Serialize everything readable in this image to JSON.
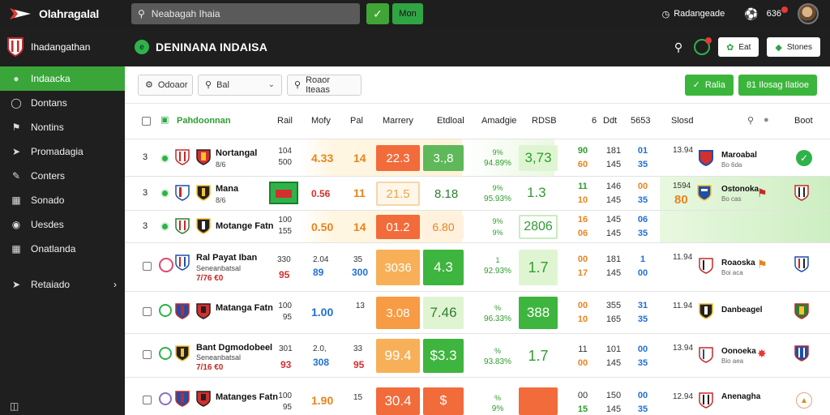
{
  "topbar": {
    "brand": "Olahragalal",
    "search_text": "Neabagah Ihaia",
    "go_label": "Mon",
    "clock_text": "Radangeade",
    "notif_text": "636"
  },
  "sidebar": {
    "header": "Ihadangathan",
    "items": [
      {
        "label": "Indaacka",
        "icon": "home-icon",
        "active": true
      },
      {
        "label": "Dontans",
        "icon": "circle-icon"
      },
      {
        "label": "Nontins",
        "icon": "flag-icon"
      },
      {
        "label": "Promadagia",
        "icon": "bolt-icon"
      },
      {
        "label": "Conters",
        "icon": "pencil-icon"
      },
      {
        "label": "Sonado",
        "icon": "car-icon"
      },
      {
        "label": "Uesdes",
        "icon": "eye-icon"
      },
      {
        "label": "Onatlanda",
        "icon": "grid-icon"
      },
      {
        "label": "Retaiado",
        "icon": "bolt-icon",
        "chevron": true
      }
    ]
  },
  "main": {
    "title": "DENINANA INDAISA",
    "btn1": "Eat",
    "btn2": "Stones"
  },
  "filters": {
    "f1": "Odoaor",
    "f2": "Bal",
    "f3": "Roaor Iteaas",
    "btn_apply": "Ralia",
    "btn_more": "81 Ilosag Ilatioe"
  },
  "table": {
    "headers": {
      "name": "Pahdoonnan",
      "h1": "Rail",
      "h2": "Mofy",
      "h3": "Pal",
      "h4": "Marrery",
      "h5": "Etdloal",
      "h6": "Amadgie",
      "h7": "RDSB",
      "h8": "6",
      "h9": "Ddt",
      "h10": "5653",
      "h11": "Slosd",
      "h12": "Boot"
    },
    "rows": [
      {
        "num": "3",
        "team": "Nortangal",
        "sub": "8/6",
        "s1": "104",
        "s2": "500",
        "v1": "4.33",
        "v2": "14",
        "big1": "22.3",
        "big2": "3.,8",
        "pct1": "9%",
        "pct2": "94.89%",
        "box3": "3,73",
        "m1": "90",
        "m2": "60",
        "m3": "181",
        "m4": "145",
        "m5": "01",
        "m6": "35",
        "time": "13.94",
        "dname": "Maroabal",
        "dsub": "Bo 6da"
      },
      {
        "num": "3",
        "team": "Mana",
        "sub": "8/6",
        "s1": "",
        "s2": "",
        "v1": "0.56",
        "v2": "11",
        "big1": "21.5",
        "big2": "8.18",
        "pct1": "9%",
        "pct2": "95.93%",
        "box3": "1.3",
        "m1": "11",
        "m2": "10",
        "m3": "146",
        "m4": "145",
        "m5": "00",
        "m6": "35",
        "time": "1594",
        "dname": "Ostonoka",
        "dsub": "Bo cas",
        "score": "80"
      },
      {
        "num": "3",
        "team": "Motange Fatn",
        "sub": "",
        "s1": "100",
        "s2": "155",
        "v1": "0.50",
        "v2": "14",
        "big1": "01.2",
        "big2": "6.80",
        "pct1": "9%",
        "pct2": "9%",
        "box3": "2806",
        "m1": "16",
        "m2": "06",
        "m3": "145",
        "m4": "145",
        "m5": "06",
        "m6": "35",
        "time": "",
        "dname": "",
        "dsub": ""
      },
      {
        "num": "",
        "team": "Ral Payat Iban",
        "sub": "Seneanbatsal",
        "odds": "7/76 €0",
        "s1": "330",
        "s2": "95",
        "v1": "2.04",
        "v2": "35",
        "v3": "300",
        "v4": "89",
        "big1": "3036",
        "big2": "4.3",
        "pct1": "1",
        "pct2": "92.93%",
        "box3": "1.7",
        "m1": "00",
        "m2": "17",
        "m3": "181",
        "m4": "145",
        "m5": "1",
        "m6": "00",
        "time": "11.94",
        "dname": "Roaoska",
        "dsub": "Boi aca"
      },
      {
        "num": "",
        "team": "Matanga Fatn",
        "sub": "",
        "s1": "100",
        "s2": "95",
        "v1": "1.00",
        "v2": "13",
        "big1": "3.08",
        "big2": "7.46",
        "pct1": "%",
        "pct2": "96.33%",
        "box3": "388",
        "m1": "00",
        "m2": "10",
        "m3": "355",
        "m4": "165",
        "m5": "31",
        "m6": "35",
        "time": "11.94",
        "dname": "Danbeagel",
        "dsub": ""
      },
      {
        "num": "",
        "team": "Bant Dgmodobeel",
        "sub": "Seneanbatsal",
        "odds": "7/16 €0",
        "s1": "301",
        "s2": "93",
        "v1": "2.0,",
        "v2": "33",
        "v3": "308",
        "v4": "95",
        "big1": "99.4",
        "big2": "$3.3",
        "pct1": "%",
        "pct2": "93.83%",
        "box3": "1.7",
        "m1": "11",
        "m2": "00",
        "m3": "101",
        "m4": "145",
        "m5": "00",
        "m6": "35",
        "time": "13.94",
        "dname": "Oonoeka",
        "dsub": "Bio aea"
      },
      {
        "num": "",
        "team": "Matanges Fatn",
        "sub": "",
        "s1": "100",
        "s2": "95",
        "v1": "1.90",
        "v2": "15",
        "big1": "30.4",
        "big2": "$",
        "pct1": "%",
        "pct2": "9%",
        "box3": "",
        "m1": "00",
        "m2": "15",
        "m3": "150",
        "m4": "145",
        "m5": "00",
        "m6": "35",
        "time": "12.94",
        "dname": "Anenagha",
        "dsub": ""
      }
    ]
  }
}
